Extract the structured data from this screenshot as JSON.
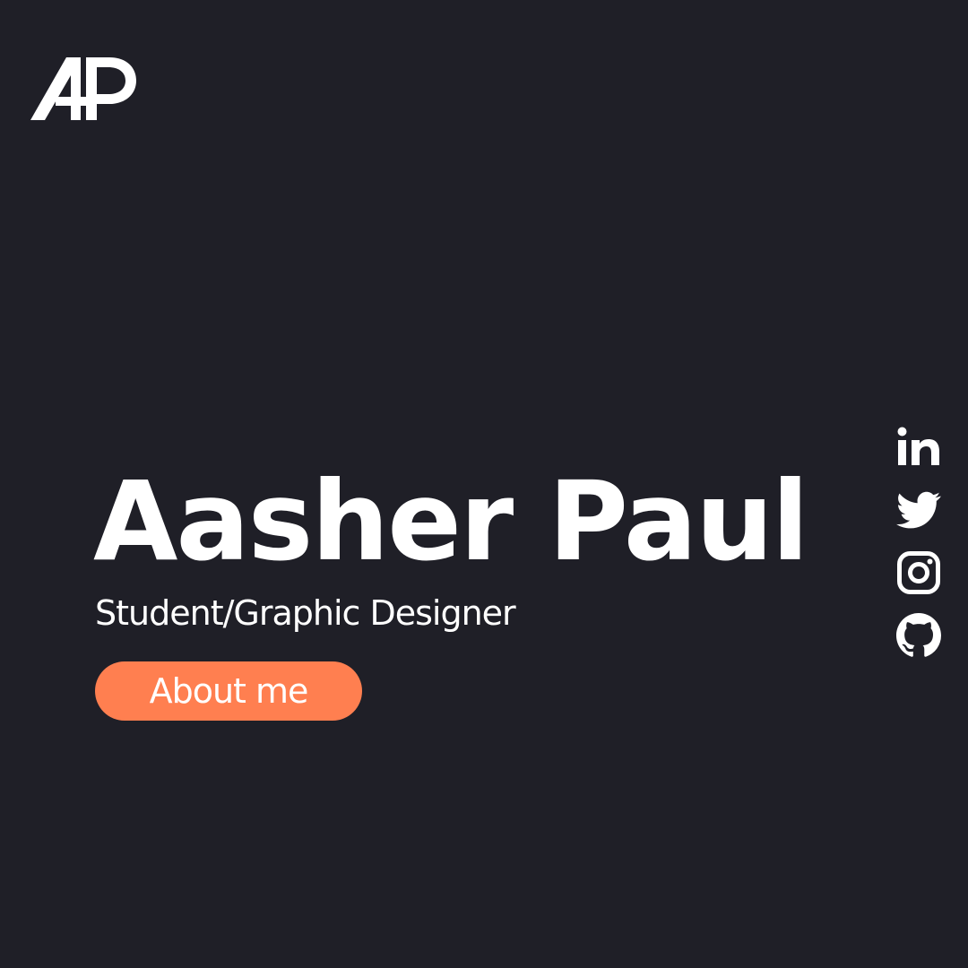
{
  "logo": {
    "text": "AP",
    "icon": "ap-monogram-logo"
  },
  "hero": {
    "name": "Aasher Paul",
    "subtitle": "Student/Graphic Designer",
    "cta_label": "About me"
  },
  "social": [
    {
      "icon": "linkedin-icon"
    },
    {
      "icon": "twitter-icon"
    },
    {
      "icon": "instagram-icon"
    },
    {
      "icon": "github-icon"
    }
  ],
  "colors": {
    "background": "#1f1f27",
    "accent": "#ff7f50",
    "text": "#ffffff"
  }
}
